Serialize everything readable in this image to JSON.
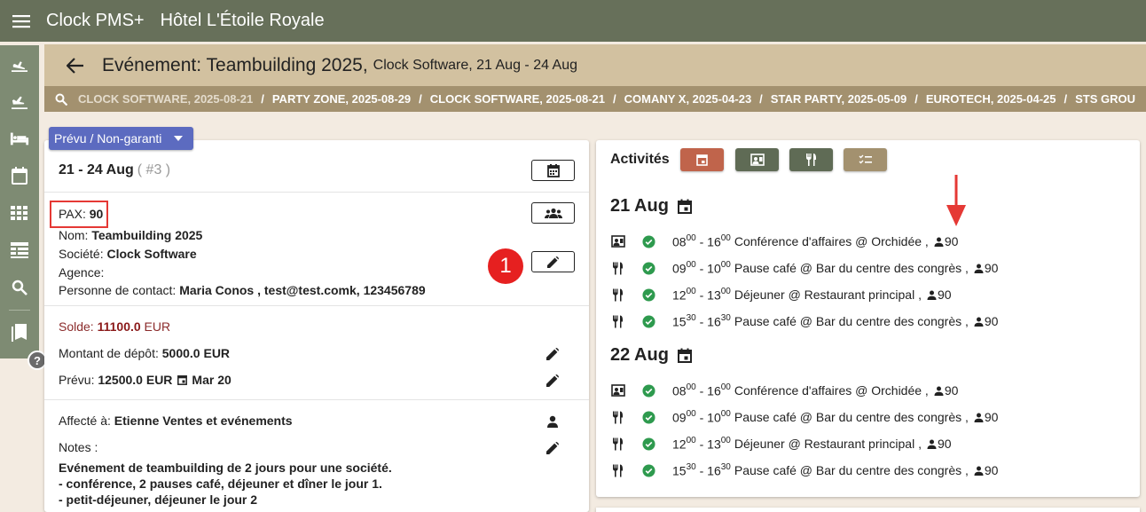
{
  "app": {
    "name": "Clock PMS+",
    "hotel": "Hôtel L'Étoile Royale"
  },
  "header": {
    "title": "Evénement: Teambuilding 2025,",
    "subtitle": "Clock Software, 21 Aug - 24 Aug"
  },
  "breadcrumbs": [
    "CLOCK SOFTWARE, 2025-08-21",
    "PARTY ZONE, 2025-08-29",
    "CLOCK SOFTWARE, 2025-08-21",
    "COMANY X, 2025-04-23",
    "STAR PARTY, 2025-05-09",
    "EUROTECH, 2025-04-25",
    "STS GROU"
  ],
  "status": {
    "label": "Prévu / Non-garanti"
  },
  "event": {
    "date_range": "21 - 24 Aug",
    "date_count": "( #3 )",
    "pax_label": "PAX:",
    "pax_value": "90",
    "name_label": "Nom:",
    "name_value": "Teambuilding 2025",
    "company_label": "Société:",
    "company_value": "Clock Software",
    "agency_label": "Agence:",
    "agency_value": "",
    "contact_label": "Personne de contact:",
    "contact_value": "Maria Conos , test@test.comk, 123456789",
    "step_badge": "1"
  },
  "money": {
    "solde_label": "Solde:",
    "solde_value": "11100.0",
    "solde_currency": "EUR",
    "deposit_label": "Montant de dépôt:",
    "deposit_value": "5000.0 EUR",
    "planned_label": "Prévu:",
    "planned_value": "12500.0 EUR",
    "planned_date": "Mar 20"
  },
  "assignment": {
    "assigned_label": "Affecté à:",
    "assigned_value": "Etienne  Ventes et evénements",
    "notes_label": "Notes :",
    "notes_text": "Evénement de teambuilding de 2 jours pour une société.\n- conférence, 2 pauses café, déjeuner et dîner le jour 1.\n- petit-déjeuner, déjeuner le jour 2"
  },
  "activities": {
    "title": "Activités",
    "filters": [
      {
        "name": "calendar-filter",
        "color": "#c0644b"
      },
      {
        "name": "meeting-filter",
        "color": "#5f6b55"
      },
      {
        "name": "food-filter",
        "color": "#5f6b55"
      },
      {
        "name": "tasks-filter",
        "color": "#a3916f"
      }
    ],
    "days": [
      {
        "label": "21 Aug",
        "items": [
          {
            "type": "meeting",
            "start_h": "08",
            "start_m": "00",
            "end_h": "16",
            "end_m": "00",
            "name": "Conférence d'affaires @ Orchidée ,",
            "pax": "90"
          },
          {
            "type": "food",
            "start_h": "09",
            "start_m": "00",
            "end_h": "10",
            "end_m": "00",
            "name": "Pause café @ Bar du centre des congrès ,",
            "pax": "90"
          },
          {
            "type": "food",
            "start_h": "12",
            "start_m": "00",
            "end_h": "13",
            "end_m": "00",
            "name": "Déjeuner @ Restaurant principal ,",
            "pax": "90"
          },
          {
            "type": "food",
            "start_h": "15",
            "start_m": "30",
            "end_h": "16",
            "end_m": "30",
            "name": "Pause café @ Bar du centre des congrès ,",
            "pax": "90"
          }
        ]
      },
      {
        "label": "22 Aug",
        "items": [
          {
            "type": "meeting",
            "start_h": "08",
            "start_m": "00",
            "end_h": "16",
            "end_m": "00",
            "name": "Conférence d'affaires @ Orchidée ,",
            "pax": "90"
          },
          {
            "type": "food",
            "start_h": "09",
            "start_m": "00",
            "end_h": "10",
            "end_m": "00",
            "name": "Pause café @ Bar du centre des congrès ,",
            "pax": "90"
          },
          {
            "type": "food",
            "start_h": "12",
            "start_m": "00",
            "end_h": "13",
            "end_m": "00",
            "name": "Déjeuner @ Restaurant principal ,",
            "pax": "90"
          },
          {
            "type": "food",
            "start_h": "15",
            "start_m": "30",
            "end_h": "16",
            "end_m": "30",
            "name": "Pause café @ Bar du centre des congrès ,",
            "pax": "90"
          }
        ]
      }
    ]
  },
  "colors": {
    "topbar": "#67705a",
    "sidenav": "#7e8b73",
    "header": "#d2c1a0",
    "breadcrumbs": "#a3916f",
    "status": "#5c6bc0",
    "check": "#2e9a4e",
    "alert": "#e53935"
  }
}
